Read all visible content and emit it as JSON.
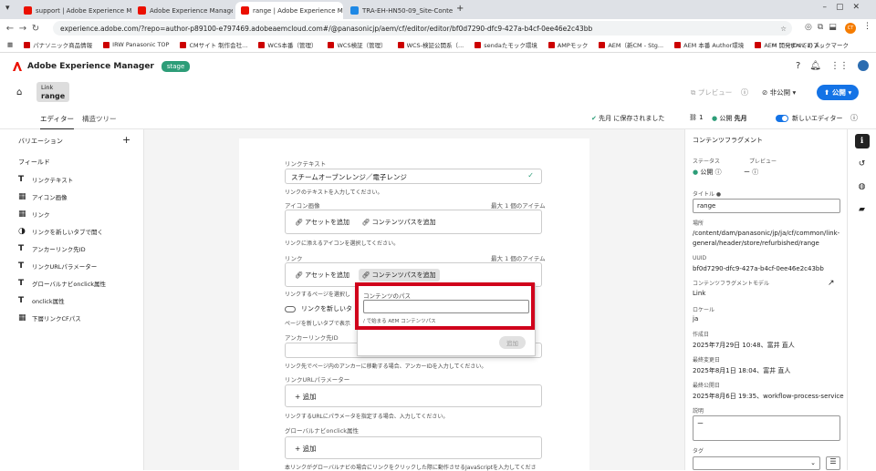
{
  "browser": {
    "tabs": [
      {
        "label": "support | Adobe Experience M",
        "color": "#eb1000"
      },
      {
        "label": "Adobe Experience Manager",
        "color": "#eb1000"
      },
      {
        "label": "range | Adobe Experience Man",
        "color": "#eb1000"
      },
      {
        "label": "TRA-EH-HN50-09_Site-Content",
        "color": "#1e88e5"
      }
    ],
    "url": "experience.adobe.com/?repo=author-p89100-e797469.adobeaemcloud.com#/@panasonicjp/aem/cf/editor/editor/bf0d7290-dfc9-427a-b4cf-0ee46e2c43bb",
    "bookmarks": [
      "パナソニック商品情報",
      "IRW Panasonic TOP",
      "CMサイト 制作会社...",
      "WCS本番（管理）",
      "WCS検証（管理）",
      "WCS-検証公開系（...",
      "sendaたモック環境",
      "AMPモック",
      "AEM（新CM - Stg...",
      "AEM 本番 Author環境",
      "AEM 開発(Dev-1) A..."
    ],
    "all_bookmarks": "すべてのブックマーク"
  },
  "aem": {
    "brand": "Adobe Experience Manager",
    "env": "stage"
  },
  "header": {
    "crumb_type": "Link",
    "crumb_name": "range",
    "preview": "プレビュー",
    "unpublish": "非公開",
    "publish": "公開"
  },
  "tabs": {
    "editor": "エディター",
    "structure": "構造ツリー"
  },
  "status": {
    "saved": "先月 に保存されました",
    "refs": "1",
    "published": "公開",
    "published_when": "先月",
    "new_editor": "新しいエディター"
  },
  "left": {
    "variation": "バリエーション",
    "fields_title": "フィールド",
    "fields": [
      {
        "icon": "T",
        "label": "リンクテキスト"
      },
      {
        "icon": "▦",
        "label": "アイコン画像"
      },
      {
        "icon": "▦",
        "label": "リンク"
      },
      {
        "icon": "◑",
        "label": "リンクを新しいタブで開く"
      },
      {
        "icon": "T",
        "label": "アンカーリンク先ID"
      },
      {
        "icon": "T",
        "label": "リンクURLパラメーター"
      },
      {
        "icon": "T",
        "label": "グローバルナビonclick属性"
      },
      {
        "icon": "T",
        "label": "onclick属性"
      },
      {
        "icon": "▦",
        "label": "下層リンクCFパス"
      }
    ]
  },
  "form": {
    "link_text_label": "リンクテキスト",
    "link_text_value": "スチームオーブンレンジ／電子レンジ",
    "link_text_help": "リンクのテキストを入力してください。",
    "icon_label": "アイコン画像",
    "icon_max": "最大 1 個のアイテム",
    "add_asset": "アセットを追加",
    "add_content_path": "コンテンツパスを追加",
    "icon_help": "リンクに添えるアイコンを選択してください。",
    "link_label": "リンク",
    "link_max": "最大 1 個のアイテム",
    "link_help": "リンクするページを選択し",
    "newtab_label": "リンクを新しいタ",
    "newtab_help": "ページを新しいタブで表示",
    "anchor_label": "アンカーリンク先ID",
    "anchor_help": "リンク先でページ内のアンカーに移動する場合、アンカーIDを入力してください。",
    "param_label": "リンクURLパラメーター",
    "add": "追加",
    "param_help": "リンクするURLにパラメータを指定する場合、入力してください。",
    "gnav_label": "グローバルナビonclick属性",
    "gnav_help": "本リンクがグローバルナビの場合にリンクをクリックした際に動作させるJavaScriptを入力してくださ"
  },
  "popover": {
    "title": "コンテンツのパス",
    "hint": "/ で始まる AEM コンテンツパス",
    "submit": "追加"
  },
  "right": {
    "title": "コンテンツフラグメント",
    "status_label": "ステータス",
    "status_value": "公開",
    "preview_label": "プレビュー",
    "preview_value": "ー",
    "title_label": "タイトル",
    "title_value": "range",
    "location_label": "場所",
    "location_value": "/content/dam/panasonic/jp/ja/cf/common/link-general/header/store/refurbished/range",
    "uuid_label": "UUID",
    "uuid_value": "bf0d7290-dfc9-427a-b4cf-0ee46e2c43bb",
    "model_label": "コンテンツフラグメントモデル",
    "model_value": "Link",
    "locale_label": "ロケール",
    "locale_value": "ja",
    "created_label": "作成日",
    "created_value": "2025年7月29日 10:48、富井 直人",
    "modified_label": "最終変更日",
    "modified_value": "2025年8月1日 18:04、富井 直人",
    "published_label": "最終公開日",
    "published_value": "2025年8月6日 19:35、workflow-process-service",
    "desc_label": "説明",
    "desc_value": "ー",
    "tags_label": "タグ"
  }
}
